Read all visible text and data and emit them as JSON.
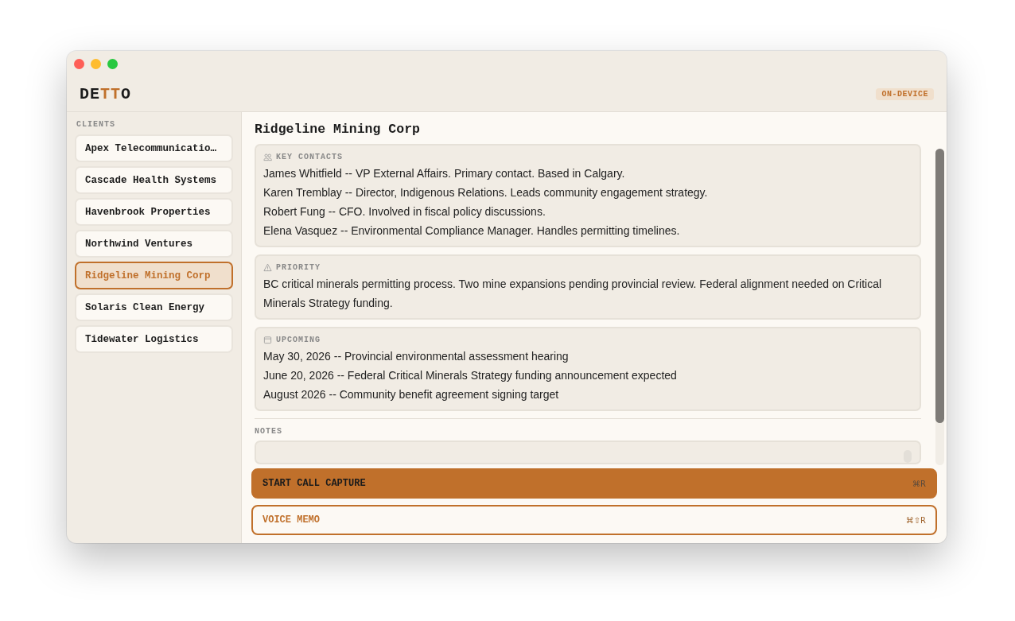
{
  "logo": [
    {
      "text": "DE",
      "accent": false
    },
    {
      "text": "TT",
      "accent": true
    },
    {
      "text": "O",
      "accent": false
    }
  ],
  "badge": "ON-DEVICE",
  "sidebar": {
    "heading": "CLIENTS",
    "items": [
      {
        "label": "Apex Telecommunicatio…",
        "selected": false
      },
      {
        "label": "Cascade Health Systems",
        "selected": false
      },
      {
        "label": "Havenbrook Properties",
        "selected": false
      },
      {
        "label": "Northwind Ventures",
        "selected": false
      },
      {
        "label": "Ridgeline Mining Corp",
        "selected": true
      },
      {
        "label": "Solaris Clean Energy",
        "selected": false
      },
      {
        "label": "Tidewater Logistics",
        "selected": false
      }
    ]
  },
  "title": "Ridgeline Mining Corp",
  "sections": [
    {
      "kind": "contacts",
      "heading": "KEY CONTACTS",
      "lines": [
        "James Whitfield -- VP External Affairs. Primary contact. Based in Calgary.",
        "Karen Tremblay -- Director, Indigenous Relations. Leads community engagement strategy.",
        "Robert Fung -- CFO. Involved in fiscal policy discussions.",
        "Elena Vasquez -- Environmental Compliance Manager. Handles permitting timelines."
      ]
    },
    {
      "kind": "priority",
      "heading": "PRIORITY",
      "lines": [
        "BC critical minerals permitting process. Two mine expansions pending provincial review. Federal alignment needed on Critical Minerals Strategy funding."
      ]
    },
    {
      "kind": "upcoming",
      "heading": "UPCOMING",
      "lines": [
        "May 30, 2026 -- Provincial environmental assessment hearing",
        "June 20, 2026 -- Federal Critical Minerals Strategy funding announcement expected",
        "August 2026 -- Community benefit agreement signing target"
      ]
    }
  ],
  "notes_label": "NOTES",
  "actions": [
    {
      "kind": "primary",
      "label": "START CALL CAPTURE",
      "shortcut": "⌘R"
    },
    {
      "kind": "secondary",
      "label": "VOICE MEMO",
      "shortcut": "⌘⇧R"
    }
  ]
}
